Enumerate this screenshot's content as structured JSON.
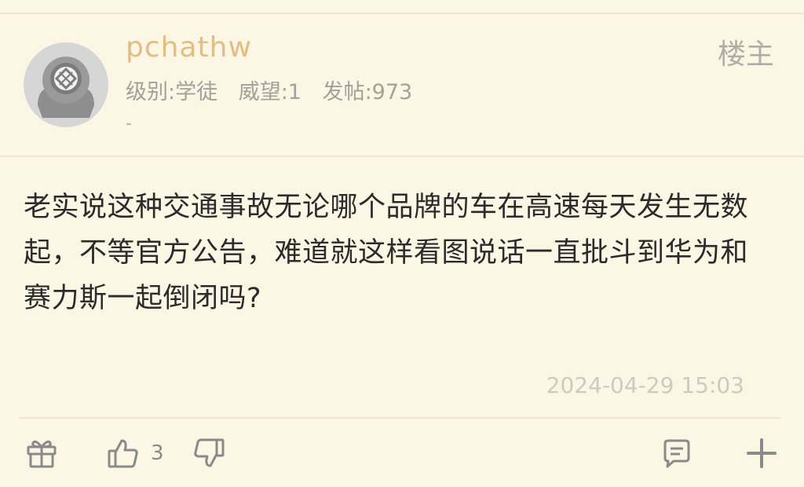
{
  "post": {
    "username": "pchathw",
    "level": "级别:学徒",
    "prestige": "威望:1",
    "post_count": "发帖:973",
    "signature": "-",
    "owner_tag": "楼主",
    "content": "老实说这种交通事故无论哪个品牌的车在高速每天发生无数起，不等官方公告，难道就这样看图说话一直批斗到华为和赛力斯一起倒闭吗?",
    "timestamp": "2024-04-29 15:03"
  },
  "actions": {
    "like_count": "3"
  },
  "icons": [
    "gift-icon",
    "thumbs-up-icon",
    "thumbs-down-icon",
    "comment-icon",
    "plus-icon"
  ],
  "colors": {
    "background": "#fcf6e4",
    "username": "#e2bd84",
    "meta": "#a4a09a",
    "content": "#2b2b2b",
    "timestamp": "#cfcac1",
    "icon": "#8a8a8a"
  }
}
